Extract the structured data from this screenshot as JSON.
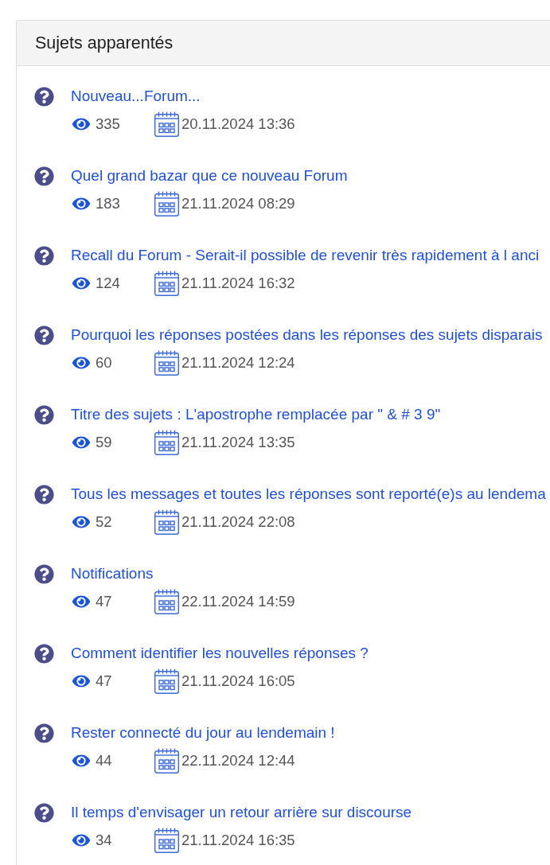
{
  "panel": {
    "title": "Sujets apparentés"
  },
  "topics": [
    {
      "title": "Nouveau...Forum...",
      "views": "335",
      "date": "20.11.2024 13:36"
    },
    {
      "title": "Quel grand bazar que ce nouveau Forum",
      "views": "183",
      "date": "21.11.2024 08:29"
    },
    {
      "title": "Recall du Forum - Serait-il possible de revenir très rapidement à l anci",
      "views": "124",
      "date": "21.11.2024 16:32"
    },
    {
      "title": "Pourquoi les réponses postées dans les réponses des sujets disparais",
      "views": "60",
      "date": "21.11.2024 12:24"
    },
    {
      "title": "Titre des sujets : L'apostrophe remplacée par \" & # 3 9\"",
      "views": "59",
      "date": "21.11.2024 13:35"
    },
    {
      "title": "Tous les messages et toutes les réponses sont reporté(e)s au lendema",
      "views": "52",
      "date": "21.11.2024 22:08"
    },
    {
      "title": "Notifications",
      "views": "47",
      "date": "22.11.2024 14:59"
    },
    {
      "title": "Comment identifier les nouvelles réponses ?",
      "views": "47",
      "date": "21.11.2024 16:05"
    },
    {
      "title": "Rester connecté du jour au lendemain !",
      "views": "44",
      "date": "22.11.2024 12:44"
    },
    {
      "title": "Il temps d'envisager un retour arrière sur discourse",
      "views": "34",
      "date": "21.11.2024 16:35"
    }
  ]
}
